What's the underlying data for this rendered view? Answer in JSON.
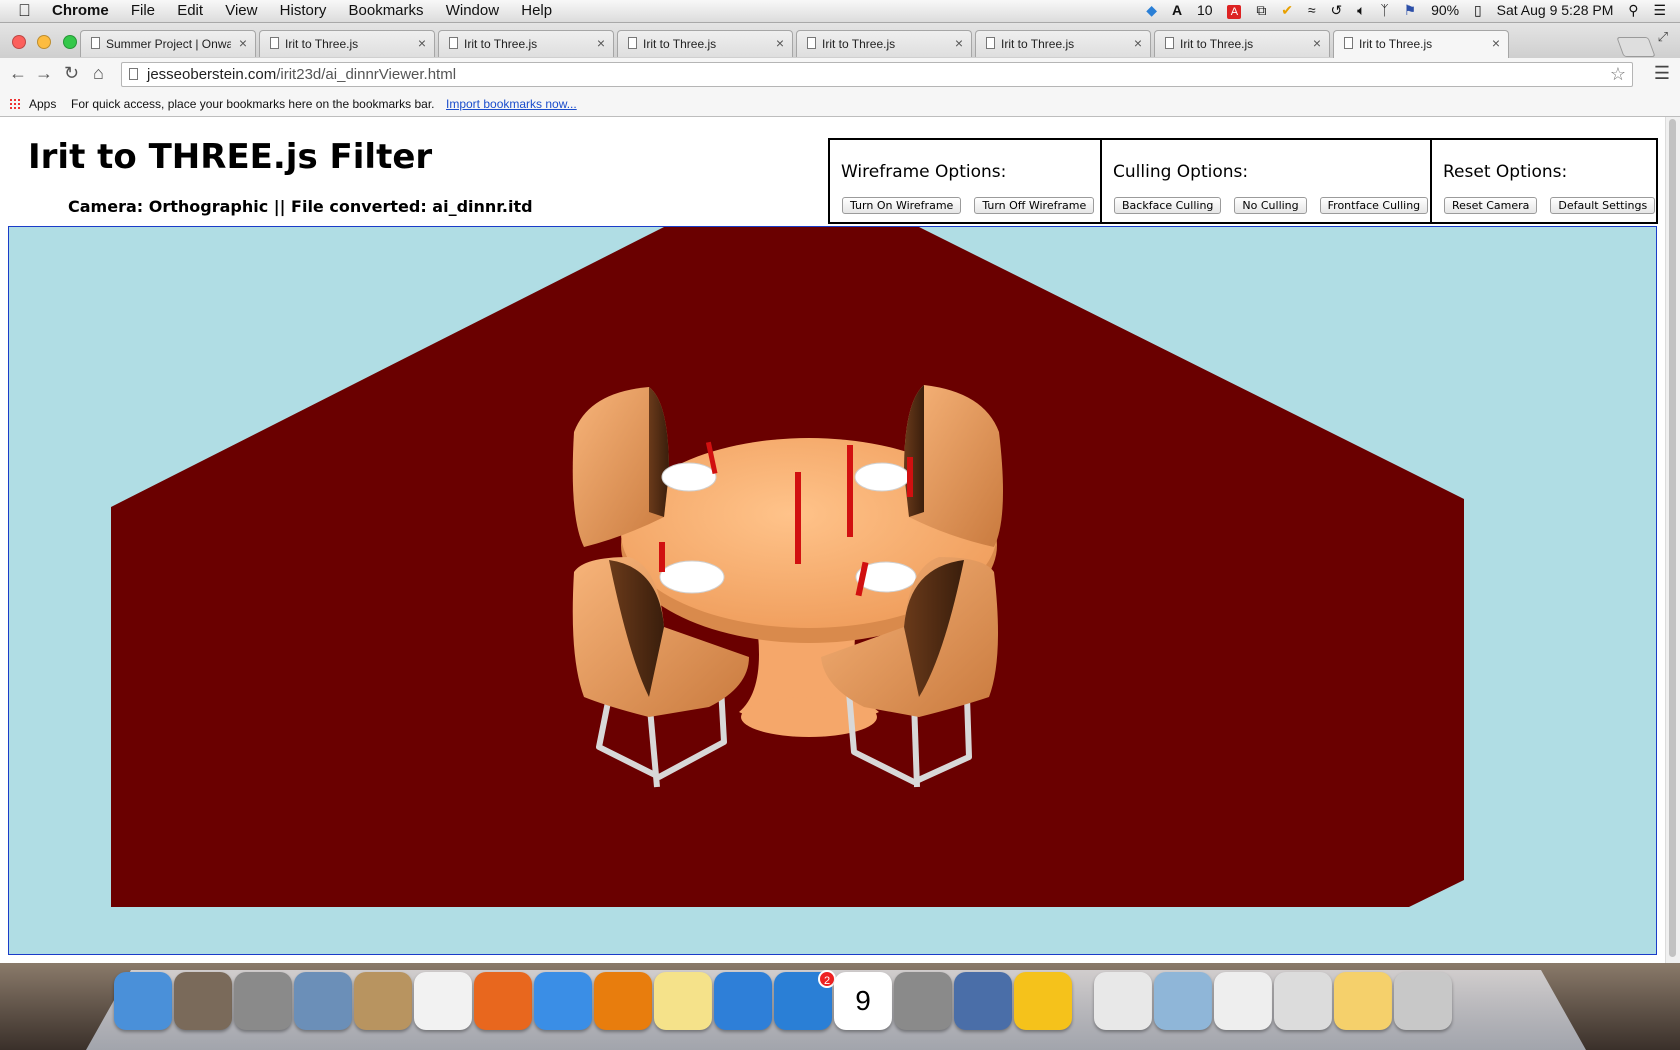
{
  "menubar": {
    "app": "Chrome",
    "items": [
      "File",
      "Edit",
      "View",
      "History",
      "Bookmarks",
      "Window",
      "Help"
    ],
    "status": {
      "adobe_count": "10",
      "battery": "90%",
      "datetime": "Sat Aug 9  5:28 PM"
    }
  },
  "tabs": [
    {
      "title": "Summer Project | Onward"
    },
    {
      "title": "Irit to Three.js"
    },
    {
      "title": "Irit to Three.js"
    },
    {
      "title": "Irit to Three.js"
    },
    {
      "title": "Irit to Three.js"
    },
    {
      "title": "Irit to Three.js"
    },
    {
      "title": "Irit to Three.js"
    },
    {
      "title": "Irit to Three.js",
      "active": true
    }
  ],
  "omnibox": {
    "host": "jesseoberstein.com",
    "path": "/irit23d/ai_dinnrViewer.html"
  },
  "bookmarks": {
    "apps": "Apps",
    "hint": "For quick access, place your bookmarks here on the bookmarks bar.",
    "import_link": "Import bookmarks now..."
  },
  "page": {
    "title": "Irit to THREE.js Filter",
    "subtitle": "Camera: Orthographic || File converted: ai_dinnr.itd",
    "options": {
      "wireframe": {
        "heading": "Wireframe Options:",
        "buttons": [
          "Turn On Wireframe",
          "Turn Off Wireframe"
        ]
      },
      "culling": {
        "heading": "Culling Options:",
        "buttons": [
          "Backface Culling",
          "No Culling",
          "Frontface Culling"
        ]
      },
      "reset": {
        "heading": "Reset Options:",
        "buttons": [
          "Reset Camera",
          "Default Settings"
        ]
      }
    }
  },
  "scene": {
    "background_color": "#b0dde4",
    "wall_color": "#6a0000",
    "table_color": "#f5a76a",
    "candle_color": "#d11010",
    "plate_color": "#ffffff",
    "leg_color": "#d8d8d8"
  },
  "dock": {
    "items": [
      {
        "icon": "finder-icon",
        "color": "#4a90d9"
      },
      {
        "icon": "photo-icon",
        "color": "#7a6a5a"
      },
      {
        "icon": "launchpad-icon",
        "color": "#8a8a8a"
      },
      {
        "icon": "mail-icon",
        "color": "#6b8fb8"
      },
      {
        "icon": "contacts-icon",
        "color": "#b89460"
      },
      {
        "icon": "reminders-icon",
        "color": "#f2f2f2"
      },
      {
        "icon": "firefox-icon",
        "color": "#e8671e"
      },
      {
        "icon": "chrome-icon",
        "color": "#3a8ee6"
      },
      {
        "icon": "blender-icon",
        "color": "#e87d0d"
      },
      {
        "icon": "stickies-icon",
        "color": "#f5e28a"
      },
      {
        "icon": "itunes-icon",
        "color": "#2e7fd8"
      },
      {
        "icon": "app-store-icon",
        "color": "#2a7fd6",
        "badge": "2"
      },
      {
        "icon": "calendar-icon",
        "color": "#ffffff",
        "label": "9"
      },
      {
        "icon": "system-preferences-icon",
        "color": "#8a8a8a"
      },
      {
        "icon": "vmware-icon",
        "color": "#4a6ea8"
      },
      {
        "icon": "cyberduck-icon",
        "color": "#f5c21b"
      },
      {
        "icon": "home-folder-icon",
        "color": "#e8e8e8"
      },
      {
        "icon": "downloads-icon",
        "color": "#8fb6d8"
      },
      {
        "icon": "document-stack-icon",
        "color": "#eeeeee"
      },
      {
        "icon": "screenshot-stack-icon",
        "color": "#dcdcdc"
      },
      {
        "icon": "duck-document-icon",
        "color": "#f5d06b"
      },
      {
        "icon": "trash-icon",
        "color": "#c8c8c8"
      }
    ]
  }
}
